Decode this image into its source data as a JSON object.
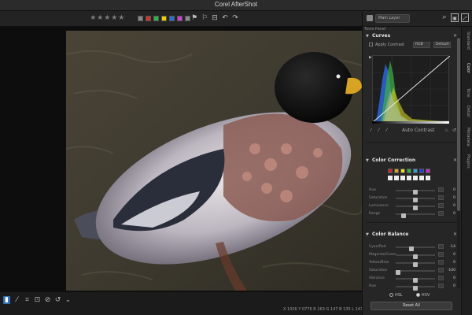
{
  "app": {
    "title": "Corel AfterShot"
  },
  "toolbar": {
    "rating_stars": [
      "★",
      "★",
      "★",
      "★",
      "★"
    ],
    "color_labels": [
      "#888888",
      "#d0342c",
      "#2fb34a",
      "#f0d000",
      "#2a6fd6",
      "#d23fd0",
      "#8a8a8a"
    ],
    "tools": [
      "⚑",
      "⚐",
      "⊟",
      "↶",
      "↷"
    ]
  },
  "right_top": {
    "layer_select": "Main Layer",
    "icons": [
      "search-icon",
      "compare-icon",
      "fullscreen-icon"
    ]
  },
  "panel": {
    "label": "Tools Panel",
    "tabs": [
      "Standard",
      "Color",
      "Tone",
      "Detail",
      "Metadata",
      "Plugins"
    ],
    "active_tab": "Color",
    "curves": {
      "title": "Curves",
      "apply_contrast": "Apply Contrast",
      "channel_select": "RGB",
      "mode_select": "Default",
      "auto_contrast": "Auto Contrast"
    },
    "color_correction": {
      "title": "Color Correction",
      "swatch_colors": [
        "#cc2a2a",
        "#e0a020",
        "#e8e020",
        "#30b040",
        "#30a0e0",
        "#2a3ae0",
        "#c030c0"
      ],
      "sliders": [
        {
          "name": "Hue",
          "value": "0",
          "level": 0.5
        },
        {
          "name": "Saturation",
          "value": "0",
          "level": 0.5
        },
        {
          "name": "Luminance",
          "value": "0",
          "level": 0.5
        },
        {
          "name": "Range",
          "value": "0",
          "level": 0.2
        }
      ]
    },
    "color_balance": {
      "title": "Color Balance",
      "sliders": [
        {
          "name": "Cyan/Red",
          "value": "-14",
          "level": 0.4
        },
        {
          "name": "Magenta/Green",
          "value": "0",
          "level": 0.5
        },
        {
          "name": "Yellow/Blue",
          "value": "0",
          "level": 0.5
        },
        {
          "name": "Saturation",
          "value": "-100",
          "level": 0.05
        },
        {
          "name": "Vibrance",
          "value": "0",
          "level": 0.5
        },
        {
          "name": "Hue",
          "value": "0",
          "level": 0.5
        }
      ],
      "radio_hsl": "HSL",
      "radio_hsv": "HSV",
      "reset": "Reset All"
    }
  },
  "status": {
    "text": "X 1026 Y 0776  R 163 G 147 B 135 L 147"
  },
  "bottom_tools": [
    "▮",
    "⁄",
    "⌗",
    "⊡",
    "⊘",
    "↺",
    "⌄"
  ]
}
